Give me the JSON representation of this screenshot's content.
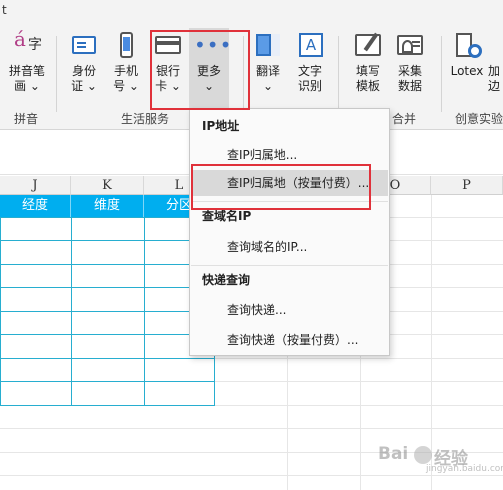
{
  "window": {
    "title_fragment": "t"
  },
  "ribbon": {
    "buttons": {
      "pinyin": {
        "line1": "拼音笔",
        "line2": "画 ⌄"
      },
      "idcard": {
        "line1": "身份",
        "line2": "证 ⌄"
      },
      "phone": {
        "line1": "手机",
        "line2": "号 ⌄"
      },
      "bankcard": {
        "line1": "银行",
        "line2": "卡 ⌄"
      },
      "more": {
        "line1": "更多",
        "line2": "⌄"
      },
      "translate": {
        "line1": "翻译",
        "line2": "⌄"
      },
      "ocr": {
        "line1": "文字",
        "line2": "识别"
      },
      "fill_template": {
        "line1": "填写",
        "line2": "模板"
      },
      "collect_data": {
        "line1": "采集",
        "line2": "数据"
      },
      "lotex": {
        "line1": "Lotex",
        "line2": ""
      },
      "add": {
        "line1": "加",
        "line2": "边"
      }
    },
    "groups": {
      "pinyin": "拼音",
      "life_services": "生活服务",
      "merge": "合并",
      "creative_lab": "创意实验"
    }
  },
  "sheet": {
    "columns": [
      "J",
      "K",
      "L",
      "",
      "O",
      "P"
    ],
    "table_headers": [
      "经度",
      "维度",
      "分区"
    ]
  },
  "dropdown": {
    "sections": [
      {
        "header": "IP地址",
        "items": [
          "查IP归属地...",
          "查IP归属地（按量付费）..."
        ]
      },
      {
        "header": "查域名IP",
        "items": [
          "查询域名的IP..."
        ]
      },
      {
        "header": "快递查询",
        "items": [
          "查询快递...",
          "查询快递（按量付费）..."
        ]
      }
    ],
    "highlighted_item": "查IP归属地（按量付费）..."
  },
  "colors": {
    "ribbon_bg": "#f3f3f3",
    "table_header_bg": "#00aeef",
    "table_border": "#27aed0",
    "annotation_red": "#e0313a",
    "menu_highlight": "#d9d9d9"
  },
  "icons": {
    "pinyin": "pinyin-icon",
    "idcard": "id-card-icon",
    "phone": "phone-icon",
    "bankcard": "bank-card-icon",
    "more": "more-dots-icon",
    "translate": "translate-icon",
    "ocr": "ocr-icon",
    "fill_template": "sign-template-icon",
    "collect_data": "id-scan-icon",
    "lotex": "lotex-gear-icon"
  },
  "watermark": {
    "brand": "Bai",
    "brand2": "经验",
    "sub": "jingyan.baidu.com"
  }
}
